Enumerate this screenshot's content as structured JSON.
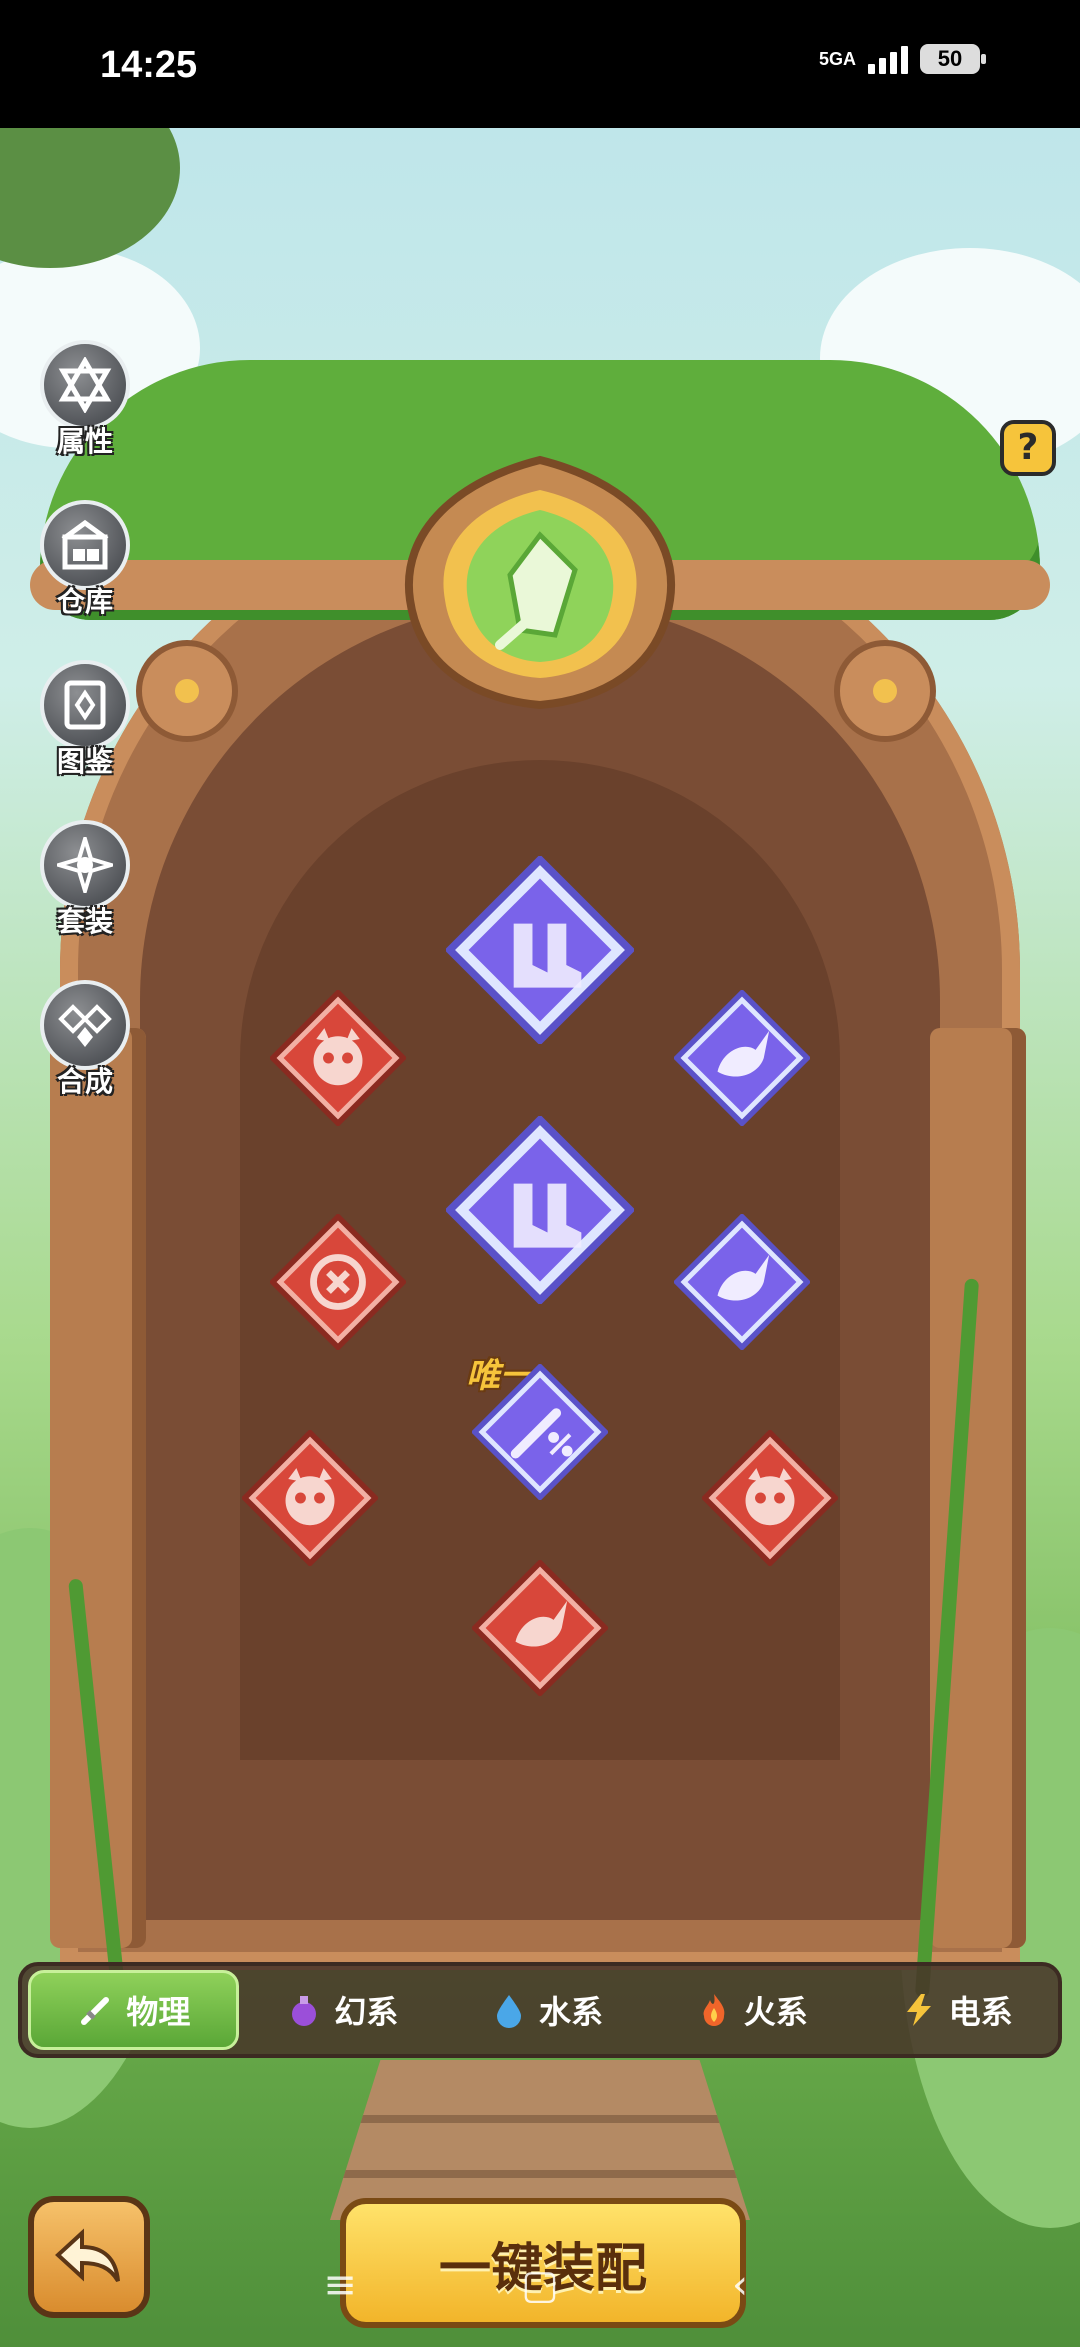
{
  "status": {
    "time": "14:25",
    "network": "5GA",
    "battery": "50"
  },
  "side_menu": [
    {
      "label": "属性",
      "icon": "star-of-david-icon"
    },
    {
      "label": "仓库",
      "icon": "warehouse-icon"
    },
    {
      "label": "图鉴",
      "icon": "book-icon"
    },
    {
      "label": "套装",
      "icon": "compass-star-icon"
    },
    {
      "label": "合成",
      "icon": "synthesis-icon"
    }
  ],
  "help": {
    "label": "?"
  },
  "gems": [
    {
      "name": "large-purple-boots-gem",
      "color": "#6f5be8",
      "icon": "boots-icon"
    },
    {
      "name": "red-monster-gem-top-left",
      "color": "#d8473a",
      "icon": "monster-icon"
    },
    {
      "name": "purple-bird-gem-top-right",
      "color": "#6f5be8",
      "icon": "bird-icon"
    },
    {
      "name": "large-purple-boots-gem-2",
      "color": "#6f5be8",
      "icon": "boots-icon"
    },
    {
      "name": "red-eye-gem-left",
      "color": "#d8473a",
      "icon": "eye-target-icon"
    },
    {
      "name": "purple-bird-gem-right",
      "color": "#6f5be8",
      "icon": "bird-icon"
    },
    {
      "name": "unique-purple-sword-gem",
      "color": "#6f5be8",
      "icon": "sword-percent-icon"
    },
    {
      "name": "red-monster-gem-bottom-left",
      "color": "#d8473a",
      "icon": "monster-icon"
    },
    {
      "name": "red-monster-gem-bottom-right",
      "color": "#d8473a",
      "icon": "monster-icon"
    },
    {
      "name": "red-bird-gem-bottom",
      "color": "#d8473a",
      "icon": "bird-icon"
    }
  ],
  "unique_label": "唯一",
  "tabs": [
    {
      "label": "物理",
      "icon": "sword-icon",
      "active": true
    },
    {
      "label": "幻系",
      "icon": "potion-icon",
      "active": false
    },
    {
      "label": "水系",
      "icon": "water-drop-icon",
      "active": false
    },
    {
      "label": "火系",
      "icon": "fire-icon",
      "active": false
    },
    {
      "label": "电系",
      "icon": "lightning-icon",
      "active": false
    }
  ],
  "equip_button": "一键装配",
  "colors": {
    "accent_green": "#6cc043",
    "button_yellow": "#f6c43b",
    "door_brown": "#7a4d35"
  }
}
